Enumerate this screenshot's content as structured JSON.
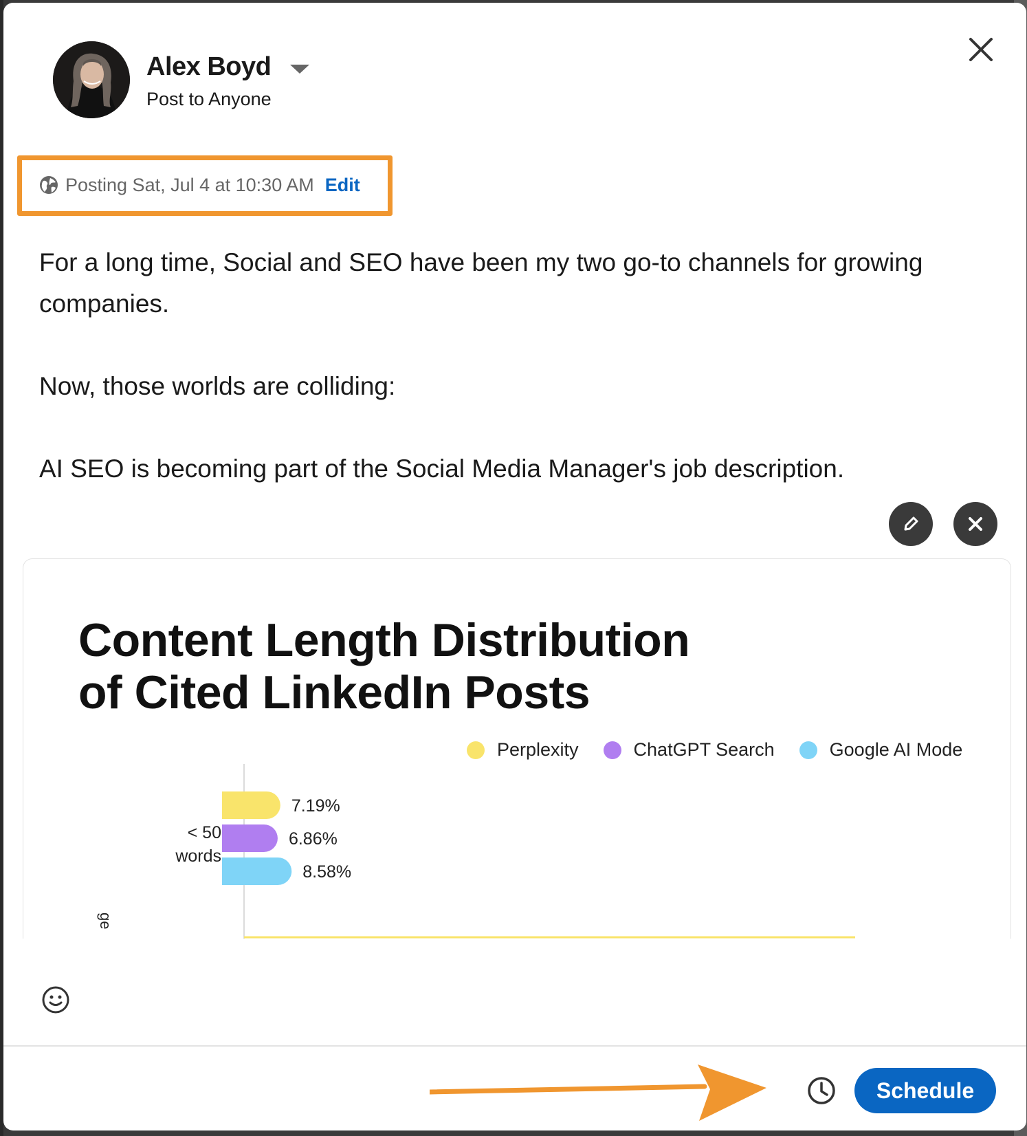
{
  "header": {
    "user_name": "Alex Boyd",
    "audience": "Post to Anyone"
  },
  "schedule": {
    "posting_text": "Posting Sat, Jul 4 at 10:30 AM",
    "edit_label": "Edit"
  },
  "post": {
    "paragraphs": [
      "For a long time, Social and SEO have been my two go-to channels for growing companies.",
      "Now, those worlds are colliding:",
      "AI SEO is becoming part of the Social Media Manager's job description."
    ]
  },
  "image": {
    "title_line1": "Content Length Distribution",
    "title_line2": "of Cited LinkedIn Posts",
    "legend": [
      {
        "label": "Perplexity",
        "color": "#f9e46b"
      },
      {
        "label": "ChatGPT Search",
        "color": "#b07ef0"
      },
      {
        "label": "Google AI Mode",
        "color": "#7fd4f7"
      }
    ],
    "partial_axis_label": "ge"
  },
  "chart_data": {
    "type": "bar",
    "orientation": "horizontal",
    "title": "Content Length Distribution of Cited LinkedIn Posts",
    "categories": [
      "< 50 words"
    ],
    "category_lines": [
      "< 50",
      "words"
    ],
    "series": [
      {
        "name": "Perplexity",
        "values": [
          7.19
        ],
        "label": "7.19%",
        "color": "#f9e46b"
      },
      {
        "name": "ChatGPT Search",
        "values": [
          6.86
        ],
        "label": "6.86%",
        "color": "#b07ef0"
      },
      {
        "name": "Google AI Mode",
        "values": [
          8.58
        ],
        "label": "8.58%",
        "color": "#7fd4f7"
      }
    ],
    "xlim": [
      0,
      100
    ],
    "legend_position": "top-right"
  },
  "footer": {
    "schedule_button": "Schedule"
  },
  "colors": {
    "accent": "#0a66c2",
    "highlight": "#f0962f"
  },
  "icons": {
    "close": "close-icon",
    "globe": "globe-icon",
    "pencil": "pencil-icon",
    "remove": "close-icon",
    "emoji": "smiley-icon",
    "clock": "clock-icon",
    "caret": "caret-down-icon"
  }
}
